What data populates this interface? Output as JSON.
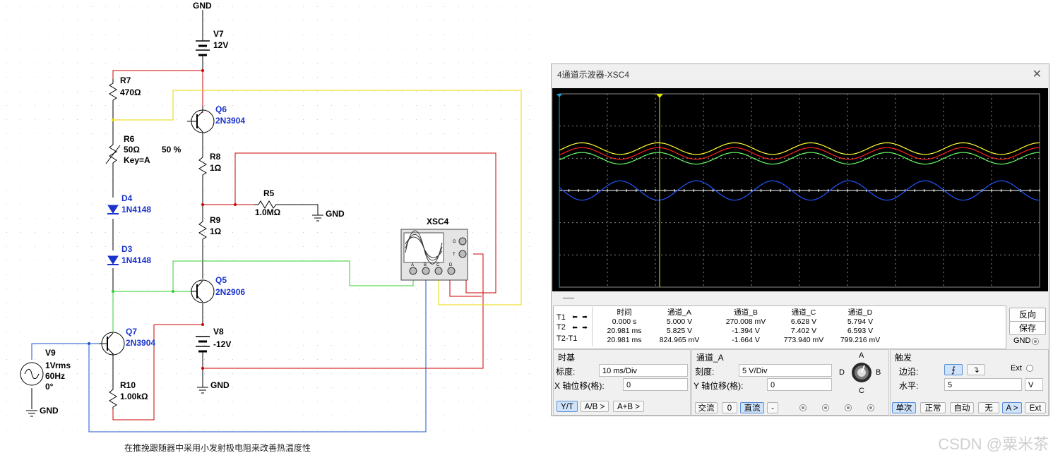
{
  "schematic": {
    "gnd_label": "GND",
    "v7": {
      "name": "V7",
      "value": "12V"
    },
    "v8": {
      "name": "V8",
      "value": "-12V"
    },
    "v9": {
      "name": "V9",
      "value1": "1Vrms",
      "value2": "60Hz",
      "value3": "0°"
    },
    "r7": {
      "name": "R7",
      "value": "470Ω"
    },
    "r6": {
      "name": "R6",
      "value": "50Ω",
      "key": "Key=A",
      "percent": "50 %"
    },
    "r8": {
      "name": "R8",
      "value": "1Ω"
    },
    "r9": {
      "name": "R9",
      "value": "1Ω"
    },
    "r5": {
      "name": "R5",
      "value": "1.0MΩ"
    },
    "r10": {
      "name": "R10",
      "value": "1.00kΩ"
    },
    "d4": {
      "name": "D4",
      "value": "1N4148"
    },
    "d3": {
      "name": "D3",
      "value": "1N4148"
    },
    "q6": {
      "name": "Q6",
      "value": "2N3904"
    },
    "q5": {
      "name": "Q5",
      "value": "2N2906"
    },
    "q7": {
      "name": "Q7",
      "value": "2N3904"
    },
    "xsc4": {
      "name": "XSC4",
      "pins": [
        "A",
        "B",
        "C",
        "D"
      ],
      "side_pins": [
        "G",
        "T"
      ]
    }
  },
  "caption": "在推挽跟随器中采用小发射极电阻来改善热温度性",
  "watermark": "CSDN @粟米茶",
  "scope": {
    "title": "4通道示波器-XSC4",
    "close_icon": "close-icon",
    "cursors": {
      "t1": "T1",
      "t2": "T2",
      "t2t1": "T2-T1",
      "headers": [
        "时间",
        "通道_A",
        "通道_B",
        "通道_C",
        "通道_D"
      ],
      "row_t1": [
        "0.000 s",
        "5.000 V",
        "270.008 mV",
        "6.628 V",
        "5.794 V"
      ],
      "row_t2": [
        "20.981 ms",
        "5.825 V",
        "-1.394 V",
        "7.402 V",
        "6.593 V"
      ],
      "row_diff": [
        "20.981 ms",
        "824.965 mV",
        "-1.664 V",
        "773.940 mV",
        "799.216 mV"
      ]
    },
    "buttons": {
      "reverse": "反向",
      "save": "保存",
      "gnd": "GND"
    },
    "timebase": {
      "title": "时基",
      "scale_label": "标度:",
      "scale_value": "10 ms/Div",
      "xpos_label": "X 轴位移(格):",
      "xpos_value": "0",
      "modes": [
        "Y/T",
        "A/B >",
        "A+B >"
      ]
    },
    "channel": {
      "title": "通道_A",
      "scale_label": "刻度:",
      "scale_value": "5  V/Div",
      "ypos_label": "Y 轴位移(格):",
      "ypos_value": "0",
      "coupling": [
        "交流",
        "0",
        "直流",
        "-"
      ],
      "knob": {
        "a": "A",
        "b": "B",
        "c": "C",
        "d": "D"
      }
    },
    "trigger": {
      "title": "触发",
      "edge_label": "边沿:",
      "ext_label": "Ext",
      "level_label": "水平:",
      "level_value": "5",
      "level_unit": "V",
      "modes": [
        "单次",
        "正常",
        "自动",
        "无",
        "A >",
        "Ext"
      ]
    },
    "colors": {
      "ch_a": "#ffff33",
      "ch_b": "#2255ff",
      "ch_c": "#ff2222",
      "ch_d": "#66ff66",
      "cursor1": "#19a6d6",
      "cursor2": "#e6e600",
      "grid": "#8a8a8a"
    },
    "waveforms": {
      "cycles_visible": 6.3,
      "ch_a": {
        "offset_div": 1.3,
        "amplitude_div": 0.18
      },
      "ch_c": {
        "offset_div": 1.15,
        "amplitude_div": 0.18
      },
      "ch_d": {
        "offset_div": 1.0,
        "amplitude_div": 0.18
      },
      "ch_b": {
        "offset_div": 0.0,
        "amplitude_div": 0.3
      }
    }
  }
}
